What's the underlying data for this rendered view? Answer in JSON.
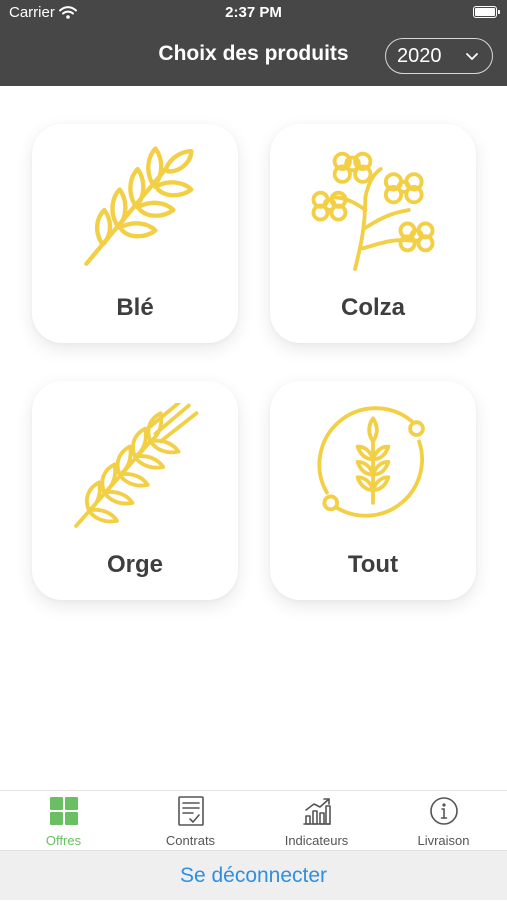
{
  "status_bar": {
    "carrier": "Carrier",
    "time": "2:37 PM"
  },
  "header": {
    "title": "Choix des produits",
    "year": "2020"
  },
  "products": [
    {
      "label": "Blé",
      "icon": "wheat-icon"
    },
    {
      "label": "Colza",
      "icon": "rapeseed-flower-icon"
    },
    {
      "label": "Orge",
      "icon": "barley-icon"
    },
    {
      "label": "Tout",
      "icon": "all-crops-icon"
    }
  ],
  "tabs": [
    {
      "label": "Offres",
      "icon": "grid-icon",
      "active": true
    },
    {
      "label": "Contrats",
      "icon": "contract-icon",
      "active": false
    },
    {
      "label": "Indicateurs",
      "icon": "chart-icon",
      "active": false
    },
    {
      "label": "Livraison",
      "icon": "info-icon",
      "active": false
    }
  ],
  "logout_label": "Se déconnecter",
  "colors": {
    "header": "#474747",
    "accent": "#f3cf45",
    "active_tab": "#6bbf63",
    "link": "#2f8fe0"
  }
}
